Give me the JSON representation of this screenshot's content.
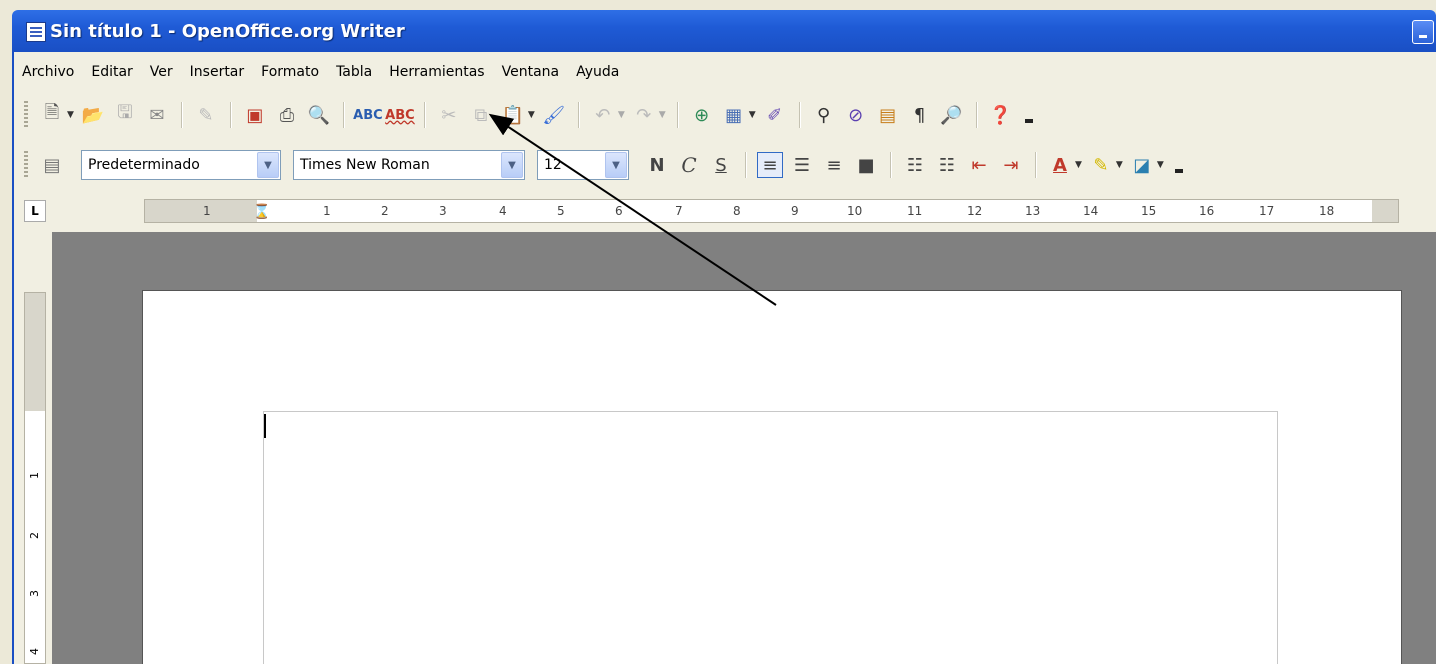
{
  "window": {
    "title": "Sin título 1 - OpenOffice.org Writer"
  },
  "menu": [
    "Archivo",
    "Editar",
    "Ver",
    "Insertar",
    "Formato",
    "Tabla",
    "Herramientas",
    "Ventana",
    "Ayuda"
  ],
  "format_toolbar": {
    "style_value": "Predeterminado",
    "font_value": "Times New Roman",
    "size_value": "12",
    "bold_label": "N",
    "italic_label": "C",
    "underline_label": "S"
  },
  "standard_toolbar": {
    "spellcheck_label": "ABC",
    "autospell_label": "ABC"
  },
  "ruler": {
    "ticks": [
      "1",
      "1",
      "2",
      "3",
      "4",
      "5",
      "6",
      "7",
      "8",
      "9",
      "10",
      "11",
      "12",
      "13",
      "14",
      "15",
      "16",
      "17",
      "18"
    ]
  },
  "vertical_ruler": {
    "ticks": [
      "1",
      "2",
      "3",
      "4"
    ]
  },
  "icons": {
    "new": "new-document-icon",
    "open": "open-folder-icon",
    "save": "save-icon",
    "email": "email-icon",
    "edit": "edit-file-icon",
    "pdf": "export-pdf-icon",
    "print": "print-icon",
    "preview": "page-preview-icon",
    "spell": "spellcheck-icon",
    "autospell": "autospellcheck-icon",
    "cut": "cut-icon",
    "copy": "copy-icon",
    "paste": "paste-icon",
    "format_paint": "format-paintbrush-icon",
    "undo": "undo-icon",
    "redo": "redo-icon",
    "hyperlink": "hyperlink-icon",
    "table": "table-icon",
    "draw": "draw-functions-icon",
    "find": "find-replace-icon",
    "navigator": "navigator-icon",
    "gallery": "gallery-icon",
    "nonprint": "nonprinting-characters-icon",
    "zoom": "zoom-icon",
    "help": "help-icon"
  }
}
